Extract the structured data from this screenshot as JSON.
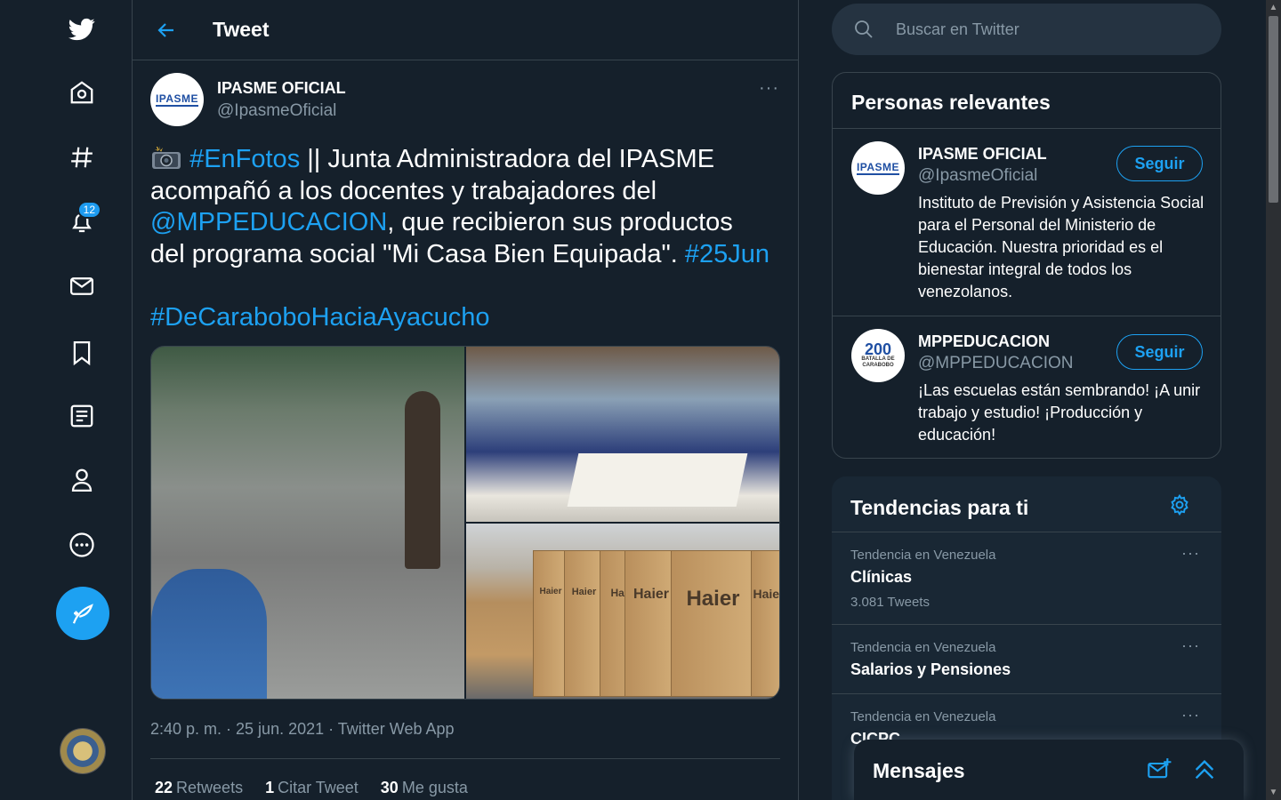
{
  "nav": {
    "items": [
      {
        "name": "twitter-logo",
        "label": "Twitter"
      },
      {
        "name": "home",
        "label": "Inicio"
      },
      {
        "name": "explore",
        "label": "Explorar"
      },
      {
        "name": "notifications",
        "label": "Notificaciones",
        "badge": "12"
      },
      {
        "name": "messages",
        "label": "Mensajes"
      },
      {
        "name": "bookmarks",
        "label": "Guardados"
      },
      {
        "name": "lists",
        "label": "Listas"
      },
      {
        "name": "profile",
        "label": "Perfil"
      },
      {
        "name": "more",
        "label": "Más opciones"
      }
    ],
    "notifications_badge": "12"
  },
  "header": {
    "title": "Tweet"
  },
  "tweet": {
    "author_name": "IPASME OFICIAL",
    "author_handle": "@IpasmeOficial",
    "avatar_text": "IPASME",
    "more": "···",
    "text_parts": {
      "hashtag1": "#EnFotos",
      "t1": " || Junta Administradora del IPASME acompañó a los docentes y trabajadores del ",
      "mention": "@MPPEDUCACION",
      "t2": ", que recibieron sus productos del programa social \"Mi Casa Bien Equipada\". ",
      "hashtag2": "#25Jun",
      "hashtag3": "#DeCaraboboHaciaAyacucho"
    },
    "box_labels": [
      "Haier",
      "Haier",
      "Haier",
      "Haier",
      "Haier",
      "Haier"
    ],
    "meta": "2:40 p. m. · 25 jun. 2021 · Twitter Web App",
    "stats": {
      "retweets_count": "22",
      "retweets_label": "Retweets",
      "quotes_count": "1",
      "quotes_label": "Citar Tweet",
      "likes_count": "30",
      "likes_label": "Me gusta"
    }
  },
  "search": {
    "placeholder": "Buscar en Twitter"
  },
  "relevant": {
    "title": "Personas relevantes",
    "people": [
      {
        "name": "IPASME OFICIAL",
        "handle": "@IpasmeOficial",
        "bio": "Instituto de Previsión y Asistencia Social para el Personal del Ministerio de Educación. Nuestra prioridad es el bienestar integral de todos los venezolanos.",
        "follow": "Seguir",
        "avatar_text": "IPASME"
      },
      {
        "name": "MPPEDUCACION",
        "handle": "@MPPEDUCACION",
        "bio": "¡Las escuelas están sembrando! ¡A unir trabajo y estudio! ¡Producción y educación!",
        "follow": "Seguir",
        "avatar_text": "200",
        "avatar_sub": "BATALLA DE CARABOBO"
      }
    ]
  },
  "trends": {
    "title": "Tendencias para ti",
    "items": [
      {
        "context": "Tendencia en Venezuela",
        "name": "Clínicas",
        "count": "3.081 Tweets"
      },
      {
        "context": "Tendencia en Venezuela",
        "name": "Salarios y Pensiones",
        "count": ""
      },
      {
        "context": "Tendencia en Venezuela",
        "name": "CICPC",
        "count": ""
      }
    ]
  },
  "messages": {
    "title": "Mensajes"
  },
  "colors": {
    "background": "#15202b",
    "accent": "#1da1f2",
    "border": "#38444d",
    "secondary_text": "#8899a6"
  }
}
